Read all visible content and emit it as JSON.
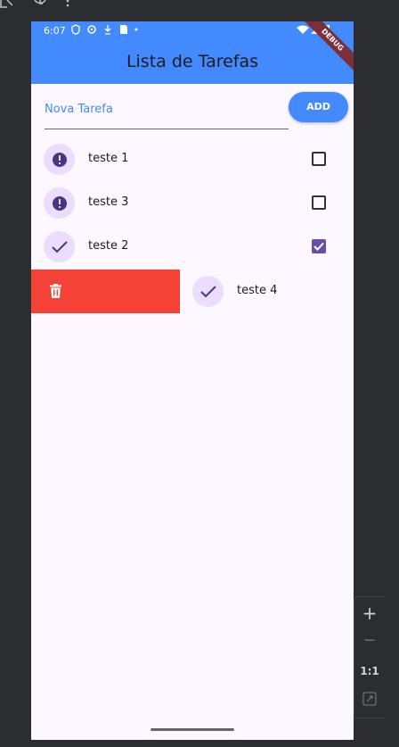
{
  "status_bar": {
    "time": "6:07"
  },
  "app": {
    "title": "Lista de Tarefas",
    "debug_banner": "DEBUG"
  },
  "input": {
    "placeholder": "Nova Tarefa",
    "value": ""
  },
  "add_button": {
    "label": "ADD"
  },
  "tasks": [
    {
      "label": "teste 1",
      "done": false,
      "icon": "exclamation-icon"
    },
    {
      "label": "teste 3",
      "done": false,
      "icon": "exclamation-icon"
    },
    {
      "label": "teste 2",
      "done": true,
      "icon": "check-icon"
    },
    {
      "label": "teste 4",
      "done": true,
      "icon": "check-icon",
      "swiping": true
    }
  ],
  "emulator_zoom": {
    "plus": "+",
    "minus": "−",
    "ratio": "1:1"
  },
  "colors": {
    "primary": "#448aff",
    "background": "#fdf7ff",
    "avatar": "#eaddff",
    "checked": "#6650a4",
    "delete": "#f44336"
  }
}
